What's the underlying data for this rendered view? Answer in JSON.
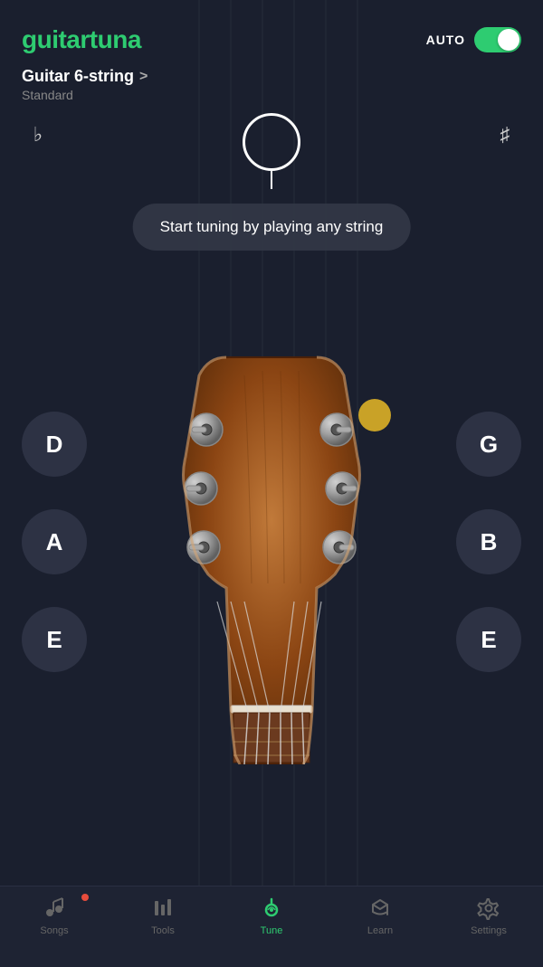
{
  "app": {
    "name_part1": "guitar",
    "name_part2": "tuna"
  },
  "header": {
    "auto_label": "AUTO",
    "toggle_on": true
  },
  "instrument": {
    "name": "Guitar 6-string",
    "chevron": ">",
    "tuning": "Standard"
  },
  "tuner": {
    "hint": "Start tuning by playing any string",
    "flat_symbol": "♭",
    "sharp_symbol": "♯"
  },
  "strings": {
    "left": [
      "D",
      "A",
      "E"
    ],
    "right": [
      "G",
      "B",
      "E"
    ]
  },
  "nav": {
    "items": [
      {
        "id": "songs",
        "label": "Songs",
        "active": false,
        "has_dot": true
      },
      {
        "id": "tools",
        "label": "Tools",
        "active": false,
        "has_dot": false
      },
      {
        "id": "tune",
        "label": "Tune",
        "active": true,
        "has_dot": false
      },
      {
        "id": "learn",
        "label": "Learn",
        "active": false,
        "has_dot": false
      },
      {
        "id": "settings",
        "label": "Settings",
        "active": false,
        "has_dot": false
      }
    ]
  }
}
